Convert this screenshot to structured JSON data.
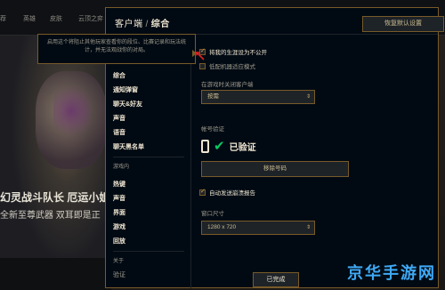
{
  "background": {
    "nav": [
      "荐",
      "英雄",
      "皮肤",
      "云顶之弈"
    ],
    "title": "幻灵战斗队长 厄运小姐",
    "subtitle": "全新至尊武器 双耳即是正"
  },
  "window": {
    "title_left": "客户端",
    "title_sep": "/",
    "title_right": "综合",
    "reset_label": "恢复默认设置",
    "done_label": "已完成"
  },
  "sidebar": {
    "items_top": [
      "综合",
      "通知弹窗",
      "聊天&好友",
      "声音",
      "语音",
      "聊天黑名单"
    ],
    "section_game": "游戏内",
    "items_game": [
      "热键",
      "声音",
      "界面",
      "游戏",
      "回放"
    ],
    "section_about": "关于",
    "items_about": [
      "验证"
    ]
  },
  "settings": {
    "privacy_label": "将我的生涯设为不公开",
    "privacy_checked": true,
    "lowspec_label": "低配机器适应模式",
    "lowspec_checked": false,
    "close_label": "在游戏时关闭客户端",
    "close_value": "按需",
    "account_label": "帐号验证",
    "verified_text": "已验证",
    "remove_label": "移除号码",
    "bug_label": "自动发送崩溃报告",
    "bug_checked": true,
    "window_size_label": "窗口尺寸",
    "window_size_value": "1280 x 720"
  },
  "tooltip": {
    "text": "启用这个将阻止其他玩家查看你的段位、比赛记录和玩法统计，并无法观战你的对局。"
  },
  "watermark": "京华手游网",
  "colors": {
    "gold": "#c8aa6e",
    "gold_dark": "#785a28",
    "verified_green": "#0ac864",
    "arrow_red": "#e02020"
  }
}
